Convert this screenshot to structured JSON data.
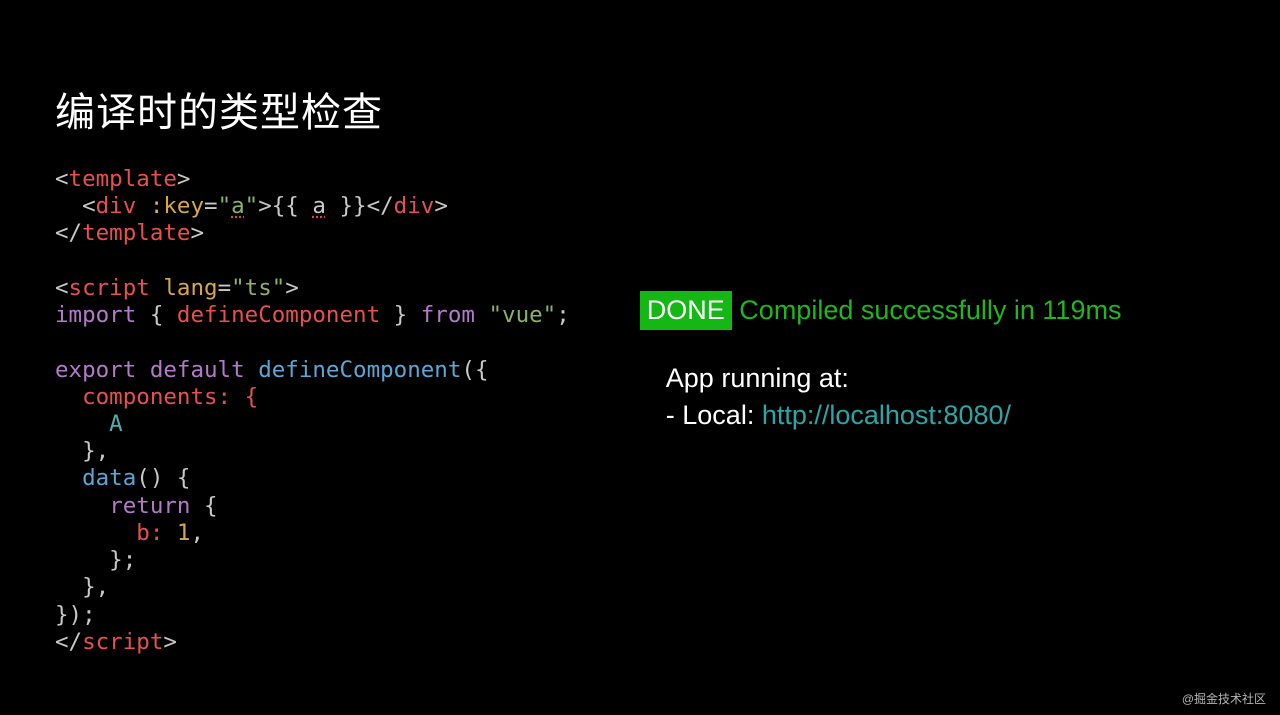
{
  "title": "编译时的类型检查",
  "code": {
    "l1a": "<",
    "l1b": "template",
    "l1c": ">",
    "l2a": "  <",
    "l2b": "div",
    "l2c": " :key",
    "l2d": "=",
    "l2e": "\"",
    "l2f": "a",
    "l2g": "\"",
    "l2h": ">{{ ",
    "l2i": "a",
    "l2j": " }}</",
    "l2k": "div",
    "l2l": ">",
    "l3a": "</",
    "l3b": "template",
    "l3c": ">",
    "l5a": "<",
    "l5b": "script",
    "l5c": " lang",
    "l5d": "=",
    "l5e": "\"ts\"",
    "l5f": ">",
    "l6a": "import",
    "l6b": " { ",
    "l6c": "defineComponent",
    "l6d": " } ",
    "l6e": "from",
    "l6f": " ",
    "l6g": "\"vue\"",
    "l6h": ";",
    "l8a": "export",
    "l8b": " ",
    "l8c": "default",
    "l8d": " ",
    "l8e": "defineComponent",
    "l8f": "({",
    "l9a": "  components: {",
    "l10a": "    A",
    "l11a": "  },",
    "l12a": "  ",
    "l12b": "data",
    "l12c": "() {",
    "l13a": "    ",
    "l13b": "return",
    "l13c": " {",
    "l14a": "      b: ",
    "l14b": "1",
    "l14c": ",",
    "l15a": "    };",
    "l16a": "  },",
    "l17a": "});",
    "l18a": "</",
    "l18b": "script",
    "l18c": ">"
  },
  "terminal": {
    "done": " DONE ",
    "success": " Compiled successfully in 119ms",
    "running": "App  running at:",
    "local_label": "- Local:   ",
    "url": "http://localhost:8080/"
  },
  "watermark": "@掘金技术社区"
}
